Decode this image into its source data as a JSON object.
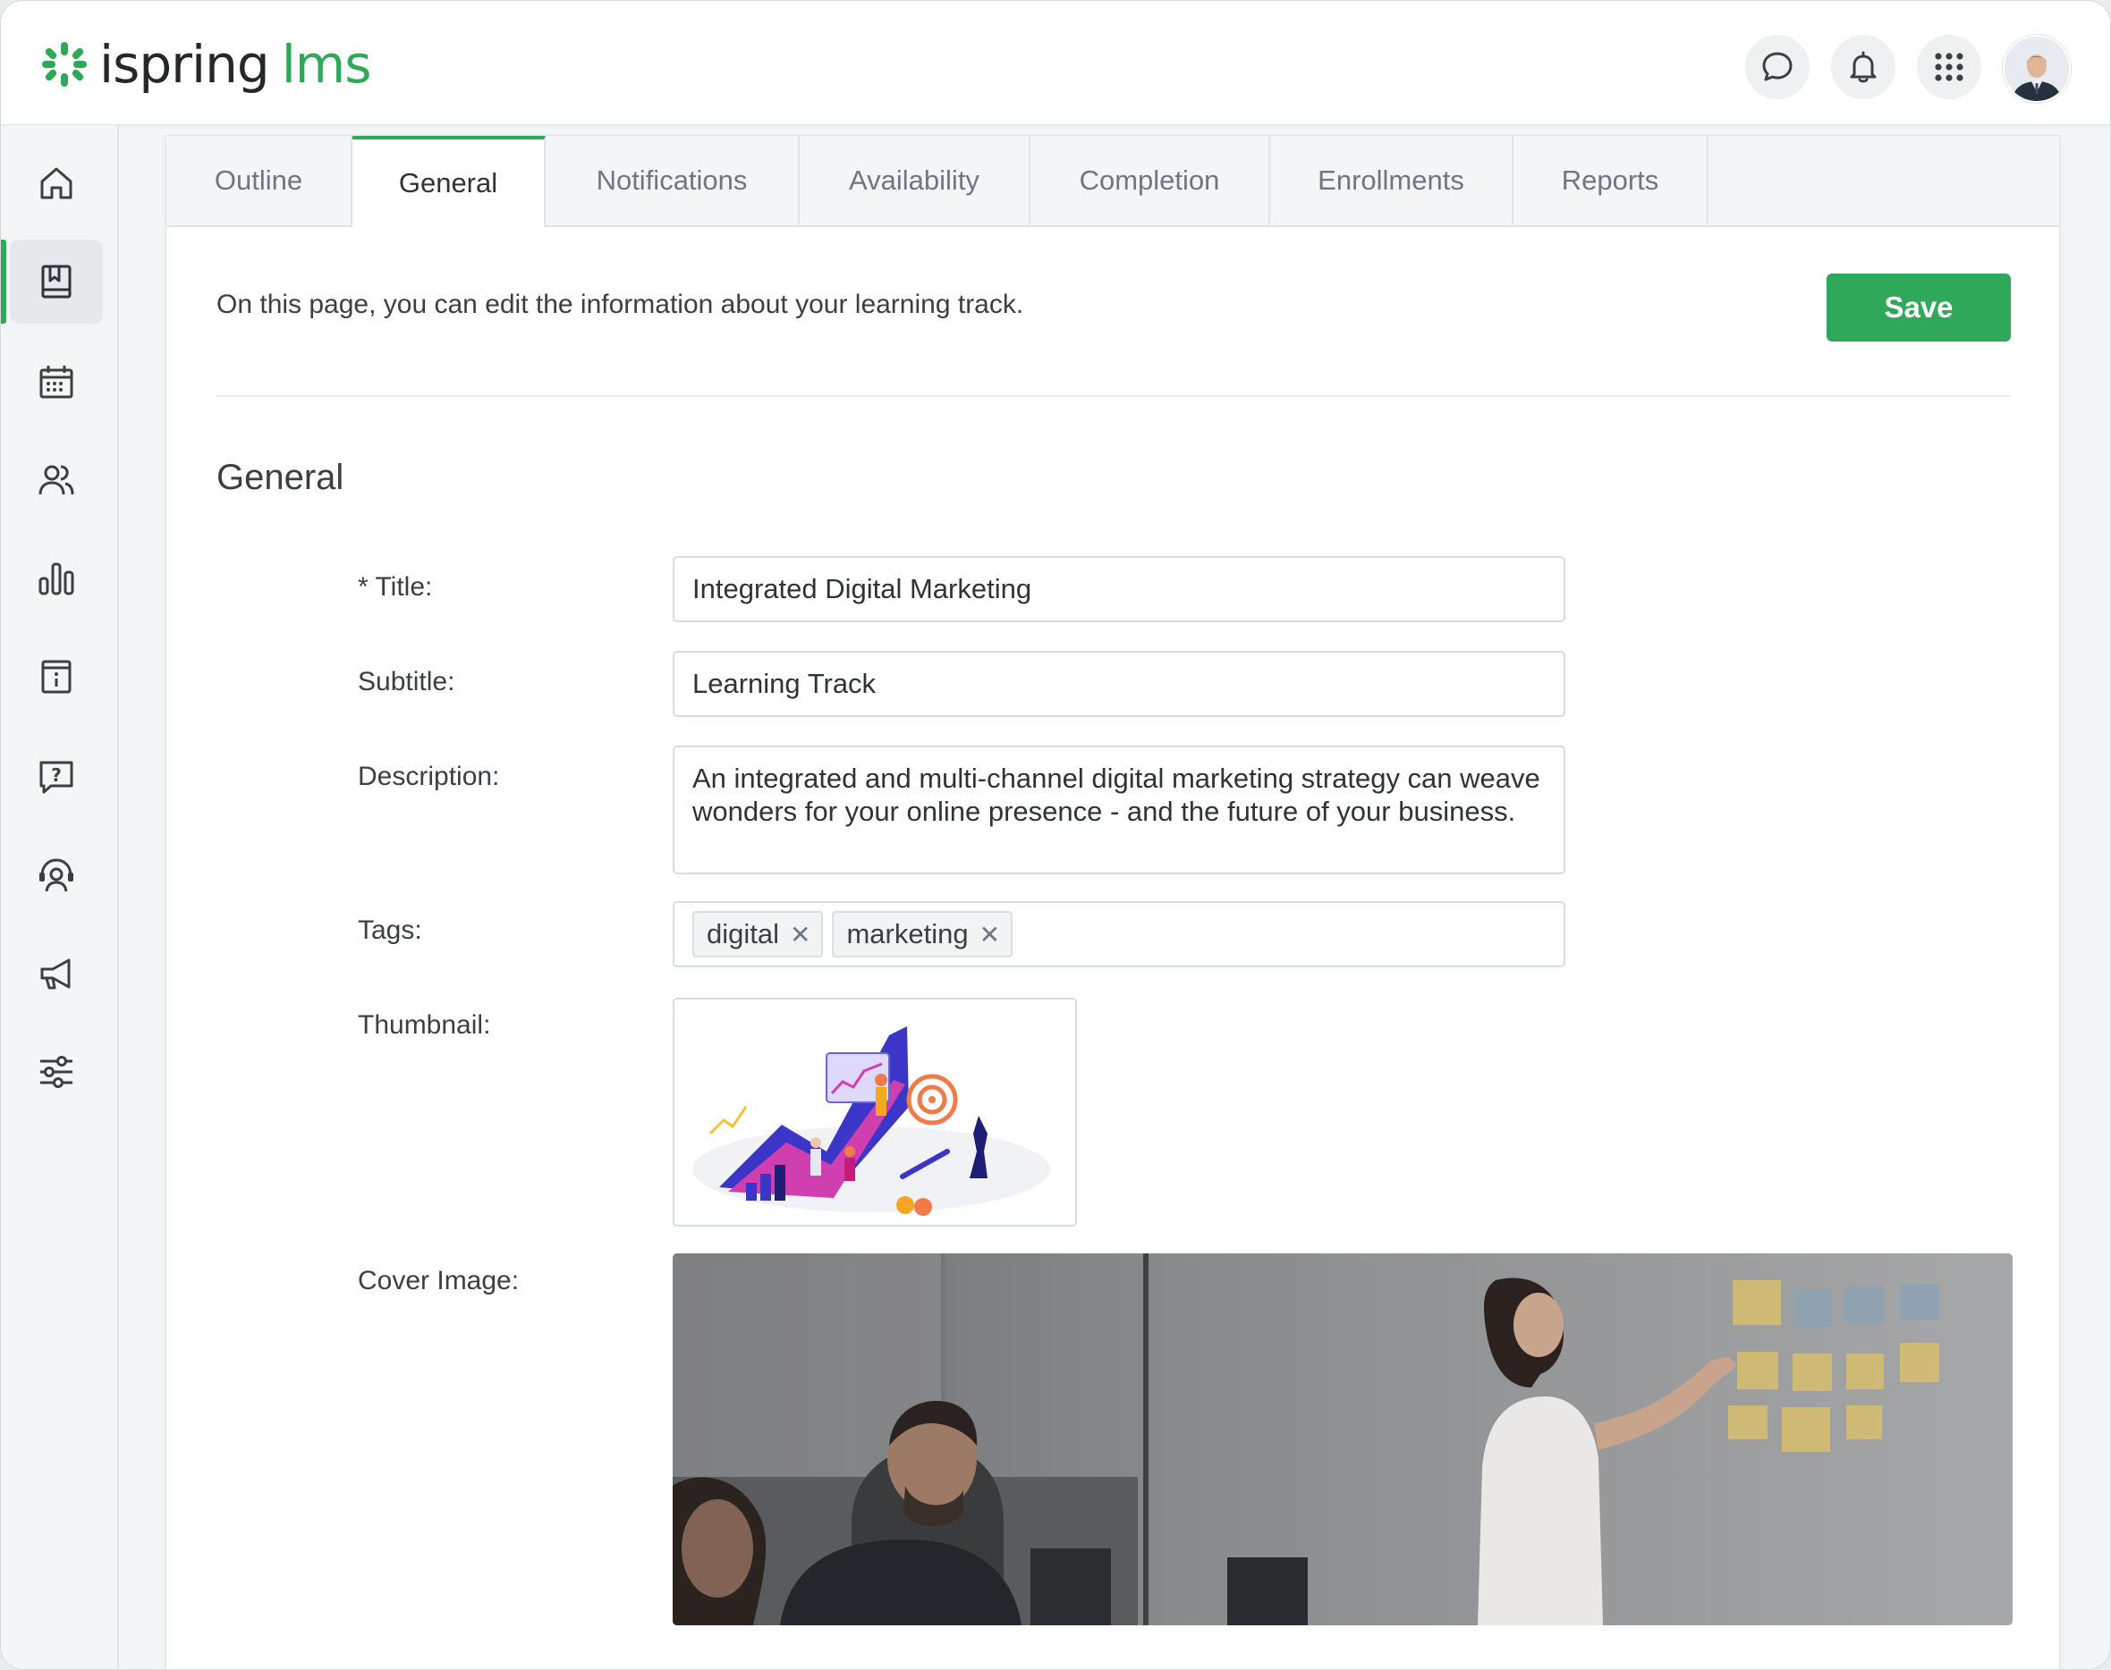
{
  "app": {
    "logo_text_1": "ispring",
    "logo_text_2": "lms",
    "brand_color": "#2fa85a"
  },
  "topbar": {
    "icons": [
      "chat-icon",
      "bell-icon",
      "apps-grid-icon",
      "user-avatar"
    ]
  },
  "sidebar": {
    "items": [
      {
        "icon": "home-icon"
      },
      {
        "icon": "courses-book-icon",
        "active": true
      },
      {
        "icon": "calendar-icon"
      },
      {
        "icon": "users-icon"
      },
      {
        "icon": "reports-bar-chart-icon"
      },
      {
        "icon": "info-document-icon"
      },
      {
        "icon": "question-chat-icon"
      },
      {
        "icon": "support-agent-icon"
      },
      {
        "icon": "megaphone-icon"
      },
      {
        "icon": "settings-sliders-icon"
      }
    ]
  },
  "tabs": [
    {
      "label": "Outline"
    },
    {
      "label": "General",
      "active": true
    },
    {
      "label": "Notifications"
    },
    {
      "label": "Availability"
    },
    {
      "label": "Completion"
    },
    {
      "label": "Enrollments"
    },
    {
      "label": "Reports"
    }
  ],
  "page": {
    "intro": "On this page, you can edit the information about your learning track.",
    "save_label": "Save",
    "section_title": "General"
  },
  "form": {
    "title_label": "* Title:",
    "title_value": "Integrated Digital Marketing",
    "subtitle_label": "Subtitle:",
    "subtitle_value": "Learning Track",
    "description_label": "Description:",
    "description_value": "An integrated and multi-channel digital marketing strategy can weave wonders for your online presence - and the future of your business.",
    "tags_label": "Tags:",
    "tags": [
      "digital",
      "marketing"
    ],
    "tag_remove_glyph": "✕",
    "thumbnail_label": "Thumbnail:",
    "cover_label": "Cover Image:"
  }
}
